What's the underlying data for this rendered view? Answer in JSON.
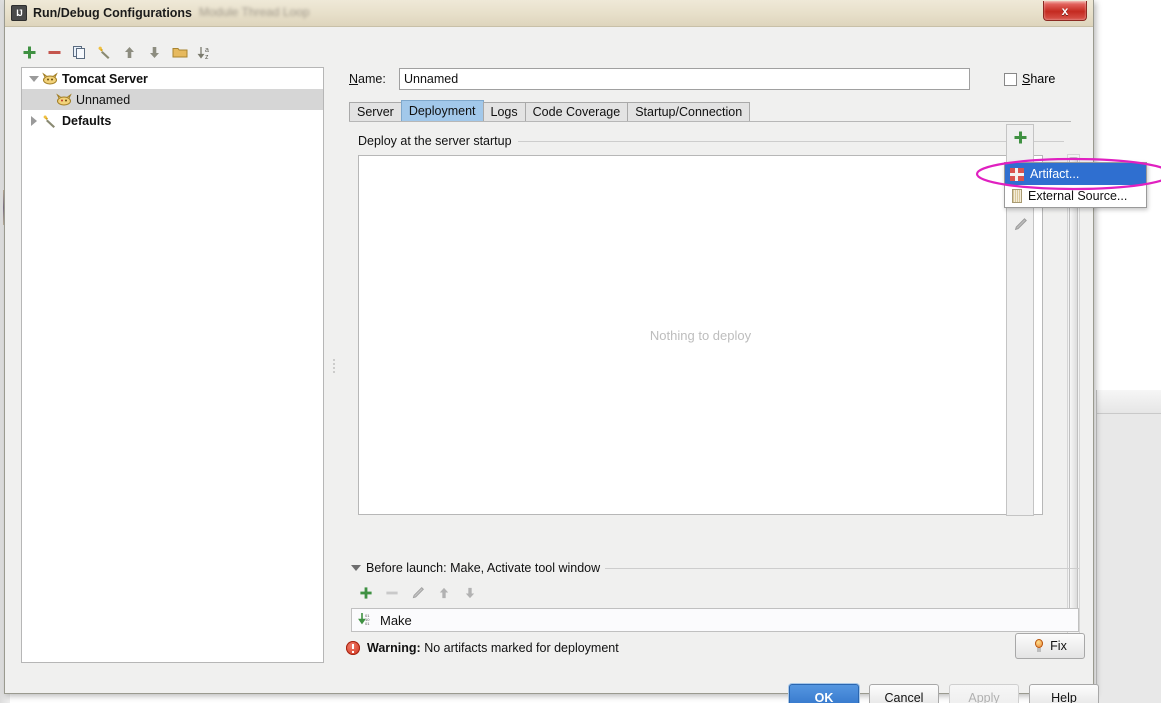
{
  "window": {
    "title": "Run/Debug Configurations",
    "ghost_title": "...",
    "close_label": "x",
    "app_icon": "intellij-idea-icon"
  },
  "left_toolbar": {
    "items": [
      {
        "name": "add-configuration-button",
        "icon": "plus-icon",
        "label": "+"
      },
      {
        "name": "remove-configuration-button",
        "icon": "minus-icon",
        "label": "–"
      },
      {
        "name": "copy-configuration-button",
        "icon": "copy-icon",
        "label": ""
      },
      {
        "name": "edit-defaults-button",
        "icon": "wrench-icon",
        "label": ""
      },
      {
        "name": "move-up-button",
        "icon": "arrow-up-icon",
        "label": ""
      },
      {
        "name": "move-down-button",
        "icon": "arrow-down-icon",
        "label": ""
      },
      {
        "name": "create-folder-button",
        "icon": "folder-icon",
        "label": ""
      },
      {
        "name": "sort-alphabetically-button",
        "icon": "sort-az-icon",
        "label": ""
      }
    ]
  },
  "tree": {
    "items": [
      {
        "label": "Tomcat Server",
        "icon": "tomcat-icon",
        "expanded": true,
        "bold": true,
        "selected": false,
        "indent": 0
      },
      {
        "label": "Unnamed",
        "icon": "tomcat-icon",
        "expanded": null,
        "bold": false,
        "selected": true,
        "indent": 1
      },
      {
        "label": "Defaults",
        "icon": "wrench-icon",
        "expanded": false,
        "bold": true,
        "selected": false,
        "indent": 0
      }
    ]
  },
  "form": {
    "name_label": "Name:",
    "name_label_accel": "N",
    "name_value": "Unnamed",
    "name_placeholder": "Unnamed",
    "share_label": "Share",
    "share_accel": "S",
    "share_checked": false
  },
  "tabs": [
    {
      "label": "Server",
      "active": false
    },
    {
      "label": "Deployment",
      "active": true
    },
    {
      "label": "Logs",
      "active": false
    },
    {
      "label": "Code Coverage",
      "active": false
    },
    {
      "label": "Startup/Connection",
      "active": false
    }
  ],
  "deployment": {
    "section_label": "Deploy at the server startup",
    "empty_text": "Nothing to deploy",
    "toolbar": [
      {
        "name": "add-deployment-button",
        "icon": "plus-icon"
      },
      {
        "name": "remove-deployment-button",
        "icon": "minus-icon"
      },
      {
        "name": "move-down-button",
        "icon": "arrow-down-icon"
      },
      {
        "name": "edit-deployment-button",
        "icon": "pencil-icon"
      }
    ]
  },
  "popup_menu": {
    "items": [
      {
        "label": "Artifact...",
        "icon": "artifact-icon",
        "selected": true
      },
      {
        "label": "External Source...",
        "icon": "external-source-icon",
        "selected": false
      }
    ]
  },
  "before_launch": {
    "header": "Before launch: Make, Activate tool window",
    "header_accel": "B",
    "toolbar": [
      {
        "name": "add-task-button",
        "icon": "plus-icon"
      },
      {
        "name": "remove-task-button",
        "icon": "minus-icon"
      },
      {
        "name": "edit-task-button",
        "icon": "pencil-icon"
      },
      {
        "name": "move-task-up-button",
        "icon": "arrow-up-icon"
      },
      {
        "name": "move-task-down-button",
        "icon": "arrow-down-icon"
      }
    ],
    "tasks": [
      {
        "label": "Make",
        "icon": "make-icon"
      }
    ]
  },
  "warning": {
    "prefix": "Warning:",
    "message": "No artifacts marked for deployment",
    "icon": "error-circle-icon"
  },
  "fix_button": {
    "label": "Fix",
    "icon": "lightbulb-icon"
  },
  "buttons": [
    {
      "label": "OK",
      "style": "primary",
      "name": "ok-button",
      "disabled": false
    },
    {
      "label": "Cancel",
      "style": "default",
      "name": "cancel-button",
      "disabled": false
    },
    {
      "label": "Apply",
      "style": "disabled",
      "name": "apply-button",
      "disabled": true
    },
    {
      "label": "Help",
      "style": "default",
      "name": "help-button",
      "disabled": false
    }
  ],
  "colors": {
    "accent_blue": "#2f6fd0",
    "tab_active": "#a2c8ea",
    "annotation": "#e020c0",
    "warning_red": "#cf2f17",
    "titlebar": "#e7dfc9"
  }
}
